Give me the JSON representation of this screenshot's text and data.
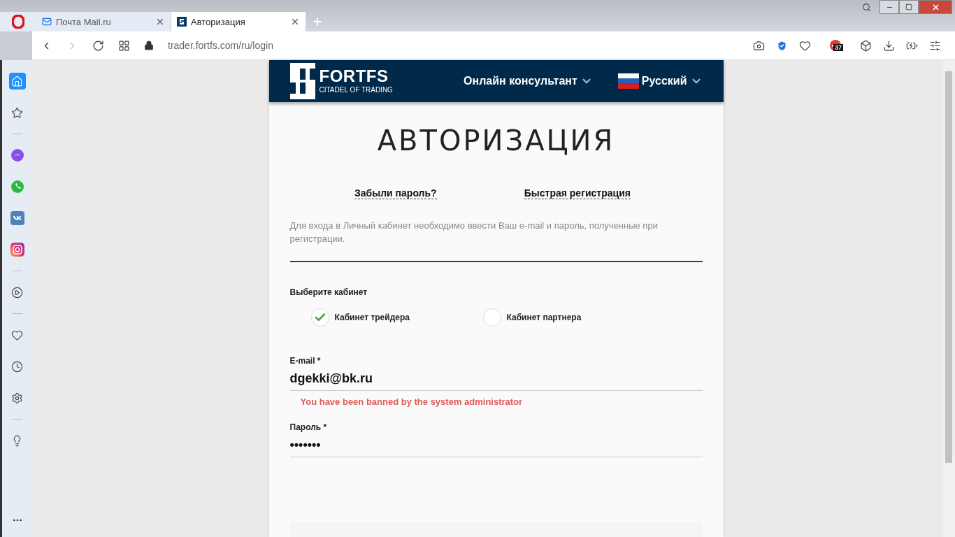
{
  "browser": {
    "tabs": [
      {
        "title": "Почта Mail.ru",
        "kind": "mail",
        "selected": false
      },
      {
        "title": "Авторизация",
        "kind": "site",
        "selected": true
      }
    ],
    "address": "trader.fortfs.com/ru/login",
    "badge": "37"
  },
  "sidebar": {
    "groups": [
      [
        {
          "kind": "home",
          "selected": true
        },
        {
          "kind": "star",
          "selected": false
        }
      ],
      [
        {
          "kind": "messenger",
          "selected": false
        },
        {
          "kind": "whatsapp",
          "selected": false
        },
        {
          "kind": "vk",
          "selected": false
        },
        {
          "kind": "instagram",
          "selected": false
        }
      ],
      [
        {
          "kind": "player",
          "selected": false
        }
      ],
      [
        {
          "kind": "heart",
          "selected": false
        },
        {
          "kind": "clock",
          "selected": false
        },
        {
          "kind": "settings",
          "selected": false
        }
      ],
      [
        {
          "kind": "bulb",
          "selected": false
        }
      ]
    ]
  },
  "header": {
    "logo": "FORTFS",
    "tagline": "CITADEL OF TRADING",
    "menu": [
      {
        "label": "Онлайн консультант",
        "kind": "dropdown"
      },
      {
        "label": "Русский",
        "kind": "language"
      }
    ]
  },
  "form": {
    "title": "АВТОРИЗАЦИЯ",
    "links": [
      "Забыли пароль?",
      "Быстрая регистрация"
    ],
    "note": "Для входа в Личный кабинет необходимо ввести Ваш e-mail и пароль, полученные при регистрации.",
    "cabinet_label": "Выберите кабинет",
    "cabinets": [
      {
        "label": "Кабинет трейдера",
        "selected": true
      },
      {
        "label": "Кабинет партнера",
        "selected": false
      }
    ],
    "email": {
      "label": "E-mail *",
      "value": "dgekki@bk.ru",
      "error": "You have been banned by the system administrator"
    },
    "password": {
      "label": "Пароль *",
      "value": "•••••••"
    }
  }
}
